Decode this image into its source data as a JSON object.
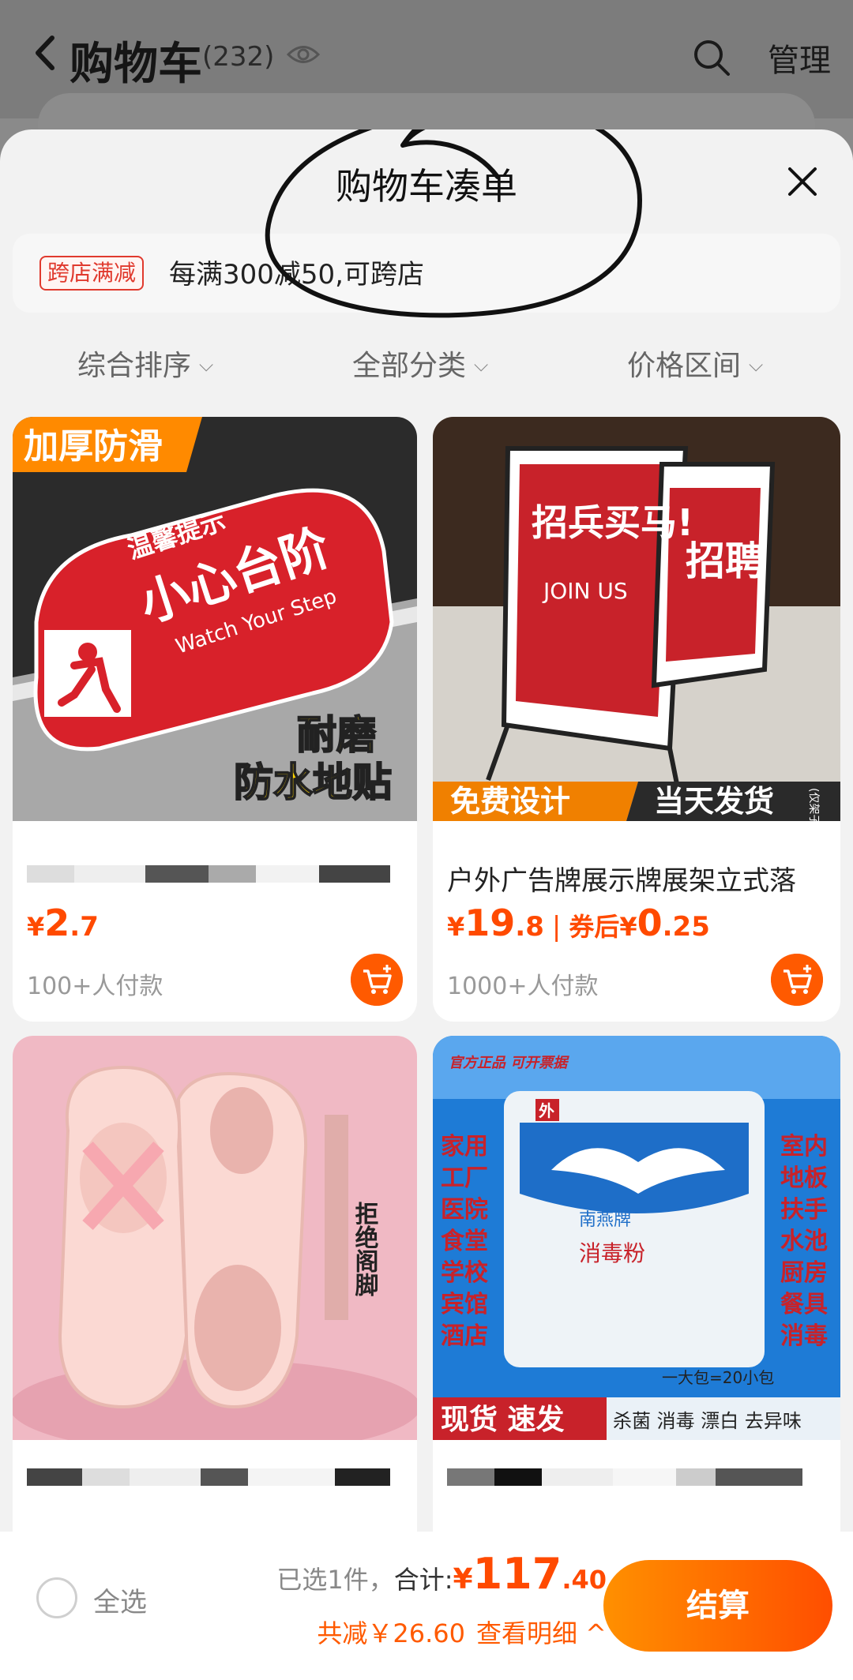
{
  "header": {
    "title": "购物车",
    "count": "(232)",
    "manage_label": "管理"
  },
  "sheet": {
    "title": "购物车凑单",
    "promo_badge": "跨店满减",
    "promo_text": "每满300减50,可跨店",
    "filters": [
      {
        "label": "综合排序"
      },
      {
        "label": "全部分类"
      },
      {
        "label": "价格区间"
      }
    ]
  },
  "products": [
    {
      "image_banner": "加厚防滑",
      "image_sign_small": "温馨提示",
      "image_sign_big": "小心台阶",
      "image_sign_en": "Watch Your Step",
      "image_badge1": "耐磨",
      "image_badge2": "防水地贴",
      "title": "",
      "price_yen": "¥",
      "price_int": "2",
      "price_dec": ".7",
      "paid": "100+人付款"
    },
    {
      "image_poster1": "招兵买马!",
      "image_poster1_en": "JOIN US",
      "image_poster2": "招聘",
      "image_band_left": "免费设计",
      "image_band_right": "当天发货",
      "image_band_note": "(仅架子)",
      "title": "户外广告牌展示牌展架立式落",
      "price_yen": "¥",
      "price_int": "19",
      "price_dec": ".8",
      "coupon_label": "券后",
      "coupon_yen": "¥",
      "coupon_int": "0",
      "coupon_dec": ".25",
      "paid": "1000+人付款"
    },
    {
      "image_side_text": "拒绝阁脚",
      "title": ""
    },
    {
      "image_stamp": "官方正品 可开票据",
      "image_left_words": [
        "家用",
        "工厂",
        "医院",
        "食堂",
        "学校",
        "宾馆",
        "酒店"
      ],
      "image_right_words": [
        "室内",
        "地板",
        "扶手",
        "水池",
        "厨房",
        "餐具",
        "消毒"
      ],
      "image_bag_brand": "南燕牌",
      "image_bag_name": "消毒粉",
      "image_bag_tag": "外",
      "image_pack_note": "一大包=20小包",
      "image_band_left": "现货 速发",
      "image_band_right": "杀菌 消毒 漂白 去异味",
      "title": ""
    }
  ],
  "bottom": {
    "select_all": "全选",
    "selected": "已选1件，",
    "total_label": "合计:",
    "total_yen": "¥",
    "total_int": "117",
    "total_dec": ".40",
    "discount": "共减￥26.60",
    "detail": "查看明细 ^",
    "checkout": "结算"
  },
  "colors": {
    "accent": "#ff5a00",
    "promo_red": "#e03a2e"
  }
}
